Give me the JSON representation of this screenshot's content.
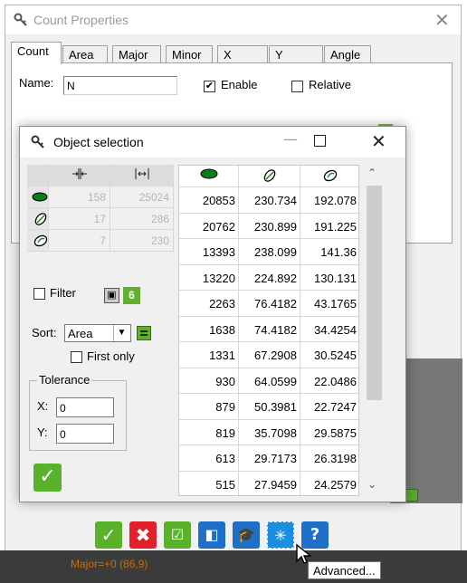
{
  "colors": {
    "accent_green": "#5ab22a",
    "danger_red": "#e0202a",
    "info_blue": "#1e6fc8",
    "status_orange": "#d06a00"
  },
  "count_properties": {
    "title": "Count Properties",
    "tabs": [
      "Count",
      "Area",
      "Major",
      "Minor",
      "X",
      "Y",
      "Angle"
    ],
    "active_tab": "Count",
    "name_label": "Name:",
    "name_value": "N",
    "enable_label": "Enable",
    "enable_checked": true,
    "relative_label": "Relative",
    "relative_checked": false,
    "status_text": "Major=+0 (86,9)",
    "tooltip": "Advanced...",
    "toolbar_icons": [
      "check-icon",
      "close-x-icon",
      "checkbox-icon",
      "contrast-icon",
      "graduation-icon",
      "sparkle-icon",
      "help-icon"
    ]
  },
  "object_selection": {
    "title": "Object selection",
    "summary": {
      "header_icons": [
        "span-in-icon",
        "span-out-icon"
      ],
      "rows": [
        {
          "icon": "filled-ellipse-icon",
          "a": "158",
          "b": "25024"
        },
        {
          "icon": "outlined-ellipse-icon",
          "a": "17",
          "b": "286"
        },
        {
          "icon": "rotated-ellipse-icon",
          "a": "7",
          "b": "230"
        }
      ]
    },
    "filter_label": "Filter",
    "filter_checked": false,
    "sort_label": "Sort:",
    "sort_value": "Area",
    "first_only_label": "First only",
    "first_only_checked": false,
    "tolerance_label": "Tolerance",
    "tol_x_label": "X:",
    "tol_x_value": "0",
    "tol_y_label": "Y:",
    "tol_y_value": "0",
    "table": {
      "header_icons": [
        "filled-ellipse-icon",
        "outlined-ellipse-icon",
        "rotated-ellipse-icon"
      ],
      "rows": [
        [
          "20853",
          "230.734",
          "192.078"
        ],
        [
          "20762",
          "230.899",
          "191.225"
        ],
        [
          "13393",
          "238.099",
          "141.36"
        ],
        [
          "13220",
          "224.892",
          "130.131"
        ],
        [
          "2263",
          "76.4182",
          "43.1765"
        ],
        [
          "1638",
          "74.4182",
          "34.4254"
        ],
        [
          "1331",
          "67.2908",
          "30.5245"
        ],
        [
          "930",
          "64.0599",
          "22.0486"
        ],
        [
          "879",
          "50.3981",
          "22.7247"
        ],
        [
          "819",
          "35.7098",
          "29.5875"
        ],
        [
          "613",
          "29.7173",
          "26.3198"
        ],
        [
          "515",
          "27.9459",
          "24.2579"
        ]
      ]
    }
  }
}
